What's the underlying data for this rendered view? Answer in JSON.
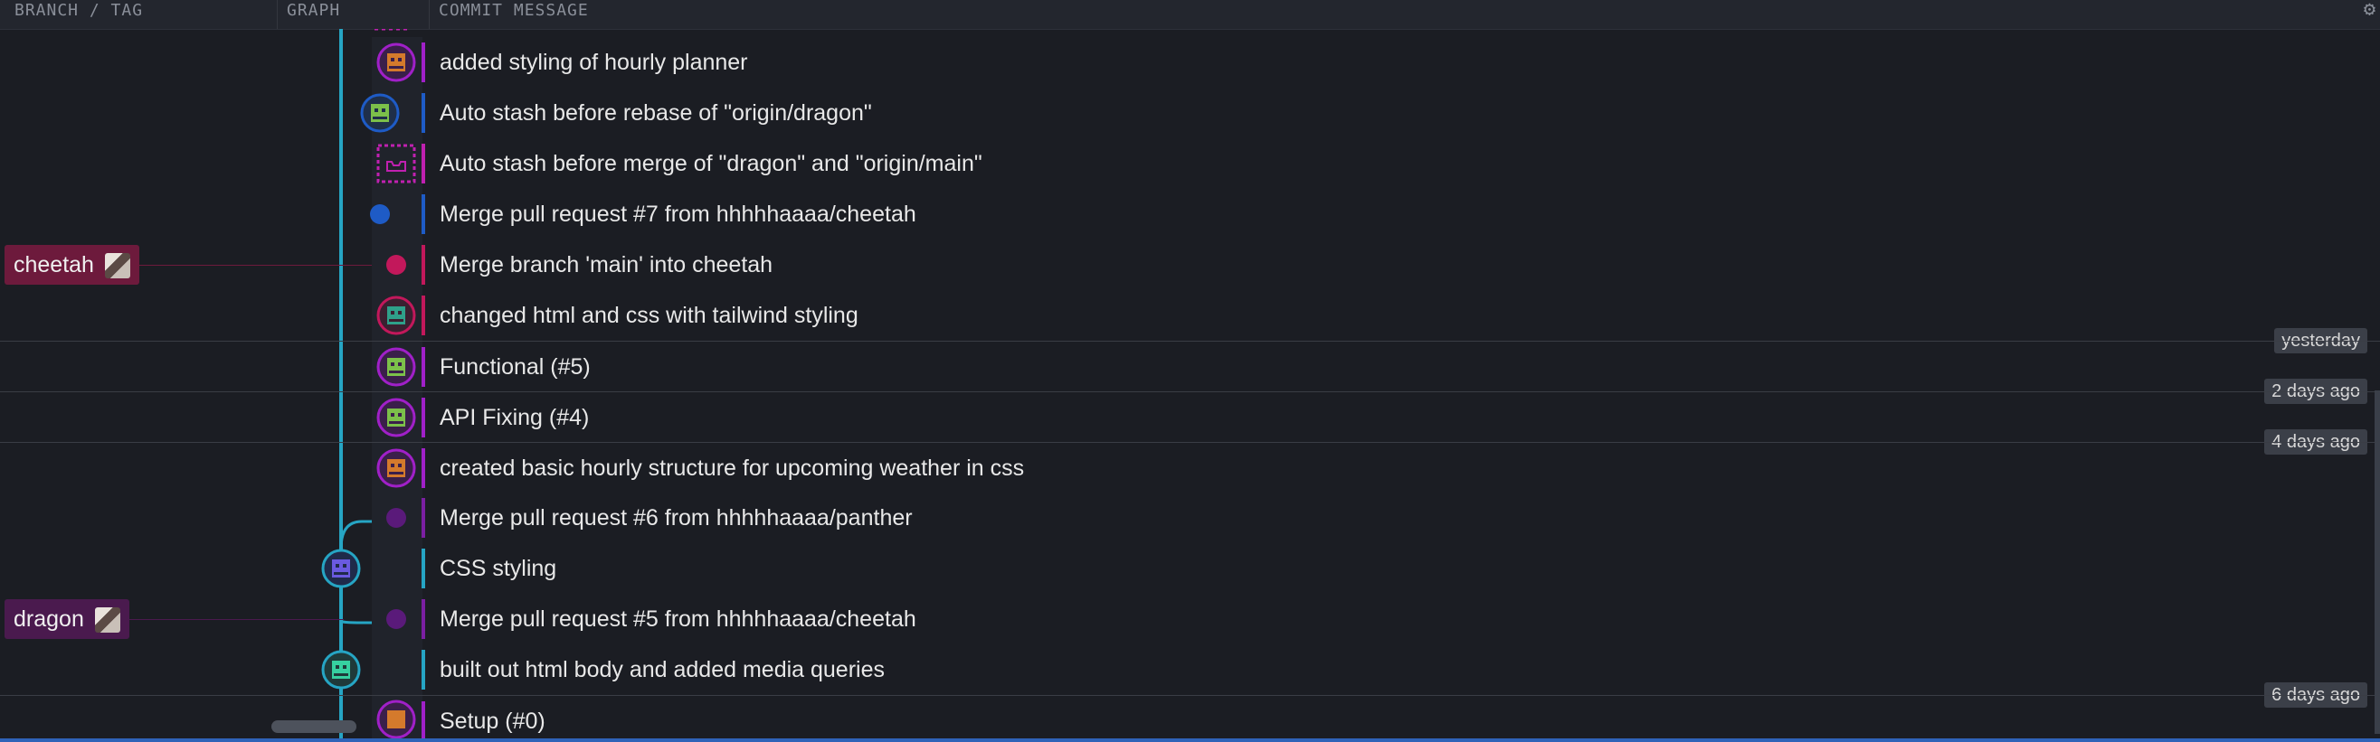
{
  "header": {
    "branch_col": "BRANCH / TAG",
    "graph_col": "GRAPH",
    "message_col": "COMMIT MESSAGE",
    "settings_icon": "gear-icon"
  },
  "commits": [
    {
      "message": "added styling of hourly planner",
      "node": "avatar",
      "color": "#a020c8"
    },
    {
      "message": "Auto stash before rebase of \"origin/dragon\"",
      "node": "avatar",
      "color": "#1e5bc6"
    },
    {
      "message": "Auto stash before merge of \"dragon\" and \"origin/main\"",
      "node": "stash",
      "color": "#c020b0"
    },
    {
      "message": "Merge pull request #7 from hhhhhaaaa/cheetah",
      "node": "dot",
      "color": "#1e5bc6"
    },
    {
      "message": "Merge branch 'main' into cheetah",
      "node": "dot",
      "color": "#c2185b"
    },
    {
      "message": "changed html and css with tailwind styling",
      "node": "avatar",
      "color": "#c2185b"
    },
    {
      "message": "Functional (#5)",
      "node": "avatar",
      "color": "#a020c8"
    },
    {
      "message": "API Fixing (#4)",
      "node": "avatar",
      "color": "#a020c8"
    },
    {
      "message": "created basic hourly structure for upcoming weather in css",
      "node": "avatar",
      "color": "#a020c8"
    },
    {
      "message": "Merge pull request #6 from hhhhhaaaa/panther",
      "node": "dot",
      "color": "#7b1fa2"
    },
    {
      "message": "CSS styling",
      "node": "avatar",
      "color": "#26a5c4"
    },
    {
      "message": "Merge pull request #5 from hhhhhaaaa/cheetah",
      "node": "dot",
      "color": "#7b1fa2"
    },
    {
      "message": "built out html body and added media queries",
      "node": "avatar",
      "color": "#26a5c4"
    },
    {
      "message": "Setup (#0)",
      "node": "avatar",
      "color": "#a020c8"
    }
  ],
  "date_markers": [
    {
      "label": "yesterday"
    },
    {
      "label": "2 days ago"
    },
    {
      "label": "4 days ago"
    },
    {
      "label": "6 days ago"
    }
  ],
  "branches": [
    {
      "name": "cheetah",
      "color": "#6d1a3c"
    },
    {
      "name": "dragon",
      "color": "#4a1a4e"
    }
  ],
  "colors": {
    "main_line": "#26a5c4",
    "cheetah": "#c2185b",
    "dragon": "#7b1fa2",
    "accent_blue": "#1e5bc6"
  }
}
